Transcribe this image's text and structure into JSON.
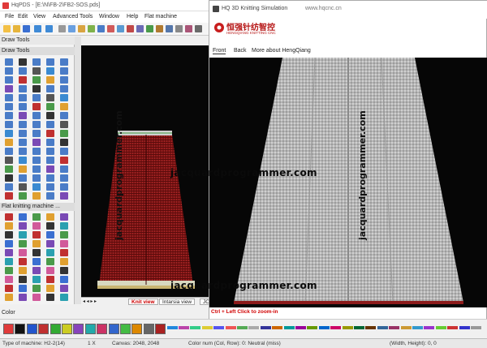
{
  "app": {
    "title": "HqPDS - [E:\\N\\FB-2\\FB2-SOS.pds]"
  },
  "menubar": [
    "File",
    "Edit",
    "View",
    "Advanced Tools",
    "Window",
    "Help",
    "Flat machine"
  ],
  "left_panel": {
    "header": "Draw Tools",
    "section1": "Draw Tools",
    "section2": "Flat knitting machine ..."
  },
  "canvas_tabs": [
    "Knit view",
    "Intarsia view",
    "JC"
  ],
  "sim": {
    "title": "HQ 3D Knitting Simulation",
    "url": "www.hqcnc.cn",
    "logo_cn": "恒强针纺智控",
    "logo_en": "HENGQIANG KNITTING CNC",
    "menu": [
      "Front",
      "Back",
      "More about HengQiang"
    ],
    "hint": "Ctrl + Left Click to zoom-in"
  },
  "color_label": "Color",
  "watermark": "jacquardprogrammer.com",
  "status": {
    "machine": "Type of machine: H2-2(14)",
    "zoom": "1 X",
    "canvas": "Canvas: 2048, 2048",
    "color_num": "Color num (Col, Row): 0: Neutral (miss)",
    "size": "(Width, Height): 0, 0"
  },
  "colors": {
    "accent_red": "#e03a3a",
    "knit_red": "#8b1a1a",
    "fabric_gray": "#b9b9b9"
  }
}
